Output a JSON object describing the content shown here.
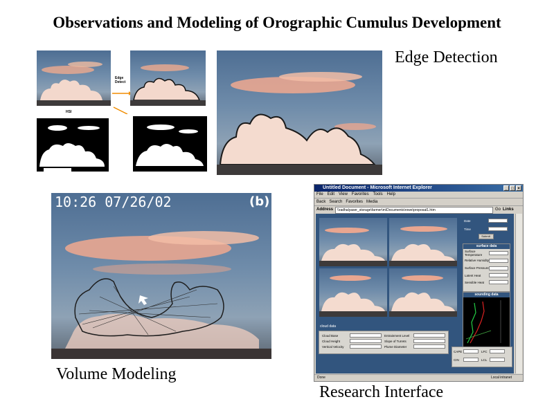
{
  "title": "Observations and Modeling of Orographic Cumulus Development",
  "captions": {
    "edge_detection": "Edge Detection",
    "volume_modeling": "Volume Modeling",
    "research_interface": "Research Interface"
  },
  "edge_panel": {
    "arrow_label_edge": "Edge Detect",
    "arrow_label_mask": "HSI"
  },
  "volume_panel": {
    "timestamp": "10:26 07/26/02",
    "panel_letter": "(b)"
  },
  "browser": {
    "window_title": "Untitled Document - Microsoft Internet Explorer",
    "menu": [
      "File",
      "Edit",
      "View",
      "Favorites",
      "Tools",
      "Help"
    ],
    "toolbar": [
      "Back",
      "Search",
      "Favorites",
      "Media"
    ],
    "address_label": "Address",
    "address_value": "\\\\radhalyaser_storage\\farmer\\m\\Documents\\rowe\\proposal1.htm",
    "go_label": "Go",
    "links_label": "Links",
    "status_left": "Done",
    "status_right": "Local intranet",
    "controls": {
      "date_label": "Date",
      "time_label": "Time",
      "submit_label": "Submit"
    },
    "surface": {
      "heading": "surface data",
      "fields": [
        "Surface Temperature",
        "Relative Humidity",
        "Surface Pressure",
        "Latent Heat",
        "Sensible Heat"
      ]
    },
    "sounding_heading": "sounding data",
    "cloud": {
      "heading": "cloud data",
      "left_fields": [
        "Cloud Base",
        "Cloud Height",
        "Vertical Velocity"
      ],
      "right_fields": [
        "Entrainment Level",
        "Slope of Turrets",
        "Plume Diameter"
      ]
    },
    "indices": {
      "cape": "CAPE",
      "lfc": "LFC",
      "cin": "CIN",
      "lcl": "LCL"
    }
  },
  "colors": {
    "page_bg": "#ffffff",
    "ie_title_bar": "#0a246a",
    "ie_content_bg": "#32557e",
    "wireframe": "#222222"
  }
}
